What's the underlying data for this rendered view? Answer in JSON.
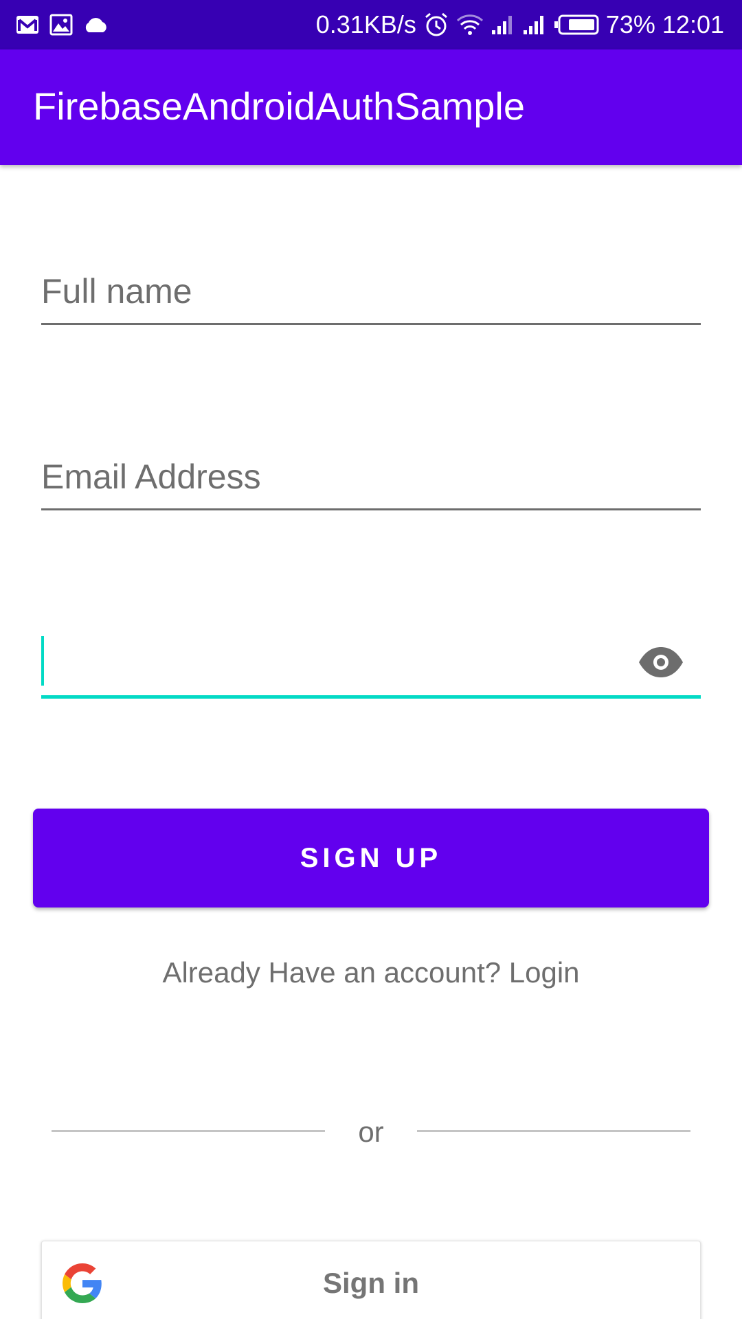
{
  "status_bar": {
    "network_speed": "0.31KB/s",
    "battery_percent": "73%",
    "time": "12:01",
    "left_icons": [
      "gmail-icon",
      "gallery-icon",
      "cloud-icon"
    ],
    "right_icons": [
      "alarm-icon",
      "wifi-icon",
      "signal-icon",
      "signal-icon",
      "battery-icon"
    ],
    "background_color": "#3700b3"
  },
  "app_bar": {
    "title": "FirebaseAndroidAuthSample",
    "background_color": "#6200ee"
  },
  "form": {
    "full_name": {
      "value": "",
      "placeholder": "Full name"
    },
    "email": {
      "value": "",
      "placeholder": "Email Address"
    },
    "password": {
      "value": "",
      "focused": true,
      "toggle_icon": "eye-icon",
      "accent_color": "#03dac5"
    }
  },
  "signup_button": {
    "label": "SIGN UP",
    "color": "#6200ee"
  },
  "login_link": {
    "text": "Already Have an account? Login"
  },
  "divider": {
    "text": "or"
  },
  "google_signin": {
    "label": "Sign in",
    "icon": "google-icon"
  }
}
